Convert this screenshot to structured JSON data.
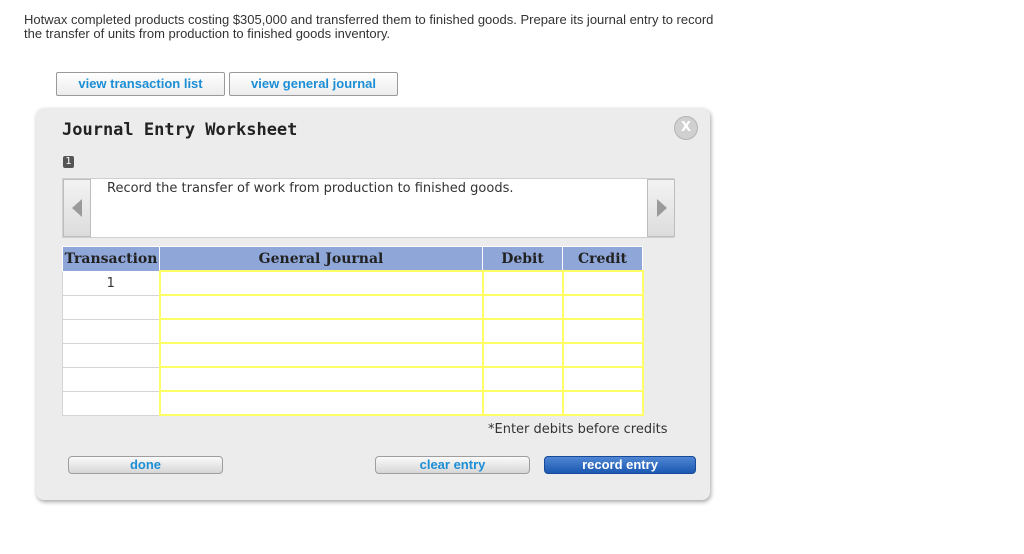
{
  "problem": {
    "text": "Hotwax completed products costing $305,000 and transferred them to finished goods. Prepare its journal entry to record the transfer of units from production to finished goods inventory."
  },
  "top_buttons": {
    "transactions_label": "view transaction list",
    "journal_label": "view general journal"
  },
  "worksheet": {
    "title": "Journal Entry Worksheet",
    "close_label": "X",
    "step_number": "1",
    "instruction": "Record the transfer of work from production to finished goods.",
    "table": {
      "headers": [
        "Transaction",
        "General Journal",
        "Debit",
        "Credit"
      ],
      "rows": [
        {
          "transaction": "1",
          "account": "",
          "debit": "",
          "credit": ""
        },
        {
          "transaction": "",
          "account": "",
          "debit": "",
          "credit": ""
        },
        {
          "transaction": "",
          "account": "",
          "debit": "",
          "credit": ""
        },
        {
          "transaction": "",
          "account": "",
          "debit": "",
          "credit": ""
        },
        {
          "transaction": "",
          "account": "",
          "debit": "",
          "credit": ""
        },
        {
          "transaction": "",
          "account": "",
          "debit": "",
          "credit": ""
        }
      ]
    },
    "note": "*Enter debits before credits",
    "buttons": {
      "done_label": "done",
      "clear_label": "clear entry",
      "record_label": "record entry"
    }
  },
  "colors": {
    "accent_text": "#1b8ed6",
    "table_header": "#8fa7d8",
    "input_border": "#ffff66",
    "record_button": "#1c58b2"
  },
  "icons": {
    "close": "close-icon",
    "previous": "arrow-left-icon",
    "next": "arrow-right-icon"
  }
}
